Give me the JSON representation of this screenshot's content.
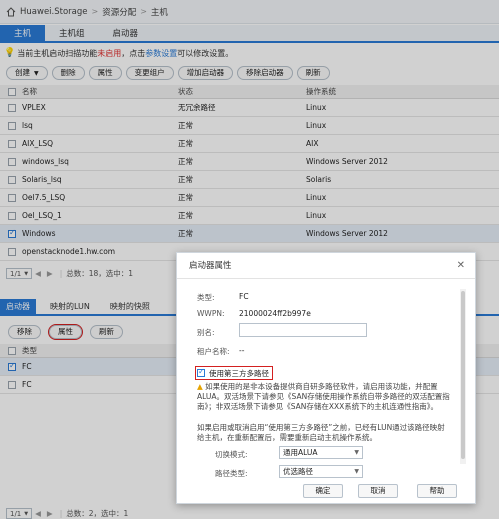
{
  "breadcrumb": [
    "Huawei.Storage",
    "资源分配",
    "主机"
  ],
  "top_tabs": [
    {
      "label": "主机",
      "active": true
    },
    {
      "label": "主机组",
      "active": false
    },
    {
      "label": "启动器",
      "active": false
    }
  ],
  "notice": {
    "part1": "当前主机启动扫描功能",
    "status": "未启用",
    "part2": "，点击",
    "link": "参数设置",
    "part3": "可以修改设置。"
  },
  "toolbar": {
    "create": "创建",
    "delete": "删除",
    "properties": "属性",
    "change_group": "变更组户",
    "add_initiator": "增加启动器",
    "remove_initiator": "移除启动器",
    "refresh": "刷新"
  },
  "host_table": {
    "headers": [
      "名称",
      "状态",
      "操作系统"
    ],
    "rows": [
      {
        "name": "VPLEX",
        "status": "无冗余路径",
        "os": "Linux",
        "checked": false
      },
      {
        "name": "lsq",
        "status": "正常",
        "os": "Linux",
        "checked": false
      },
      {
        "name": "AIX_LSQ",
        "status": "正常",
        "os": "AIX",
        "checked": false
      },
      {
        "name": "windows_lsq",
        "status": "正常",
        "os": "Windows Server 2012",
        "checked": false
      },
      {
        "name": "Solaris_lsq",
        "status": "正常",
        "os": "Solaris",
        "checked": false
      },
      {
        "name": "Oel7.5_LSQ",
        "status": "正常",
        "os": "Linux",
        "checked": false
      },
      {
        "name": "Oel_LSQ_1",
        "status": "正常",
        "os": "Linux",
        "checked": false
      },
      {
        "name": "Windows",
        "status": "正常",
        "os": "Windows Server 2012",
        "checked": true
      },
      {
        "name": "openstacknode1.hw.com",
        "status": "",
        "os": "",
        "checked": false
      }
    ]
  },
  "pager1": {
    "page": "1/1",
    "summary": "总数：18，选中：1"
  },
  "sub_tabs": [
    {
      "label": "启动器",
      "active": true
    },
    {
      "label": "映射的LUN",
      "active": false
    },
    {
      "label": "映射的快照",
      "active": false
    }
  ],
  "sub_toolbar": {
    "remove": "移除",
    "properties": "属性",
    "refresh": "刷新"
  },
  "init_table": {
    "header": "类型",
    "rows": [
      {
        "type": "FC",
        "checked": true
      },
      {
        "type": "FC",
        "checked": false
      }
    ]
  },
  "pager2": {
    "page": "1/1",
    "summary": "总数：2，选中：1"
  },
  "dialog": {
    "title": "启动器属性",
    "type_label": "类型:",
    "type_value": "FC",
    "wwpn_label": "WWPN:",
    "wwpn_value": "21000024ff2b997e",
    "alias_label": "别名:",
    "alias_value": "",
    "tenant_label": "租户名称:",
    "tenant_value": "--",
    "third_party_label": "使用第三方多路径",
    "third_party_checked": true,
    "info1": "如果使用的是非本设备提供商自研多路径软件，请启用该功能，并配置ALUA。双活场景下请参见《SAN存储使用操作系统自带多路径的双活配置指南》；非双活场景下请参见《SAN存储在XXX系统下的主机连通性指南》。",
    "info2": "如果启用或取消启用“使用第三方多路径”之前，已经有LUN通过该路径映射给主机，在重新配置后，需要重新启动主机操作系统。",
    "switch_mode_label": "切换模式:",
    "switch_mode_value": "通用ALUA",
    "path_type_label": "路径类型:",
    "path_type_value": "优选路径",
    "ok": "确定",
    "cancel": "取消",
    "help": "帮助"
  }
}
